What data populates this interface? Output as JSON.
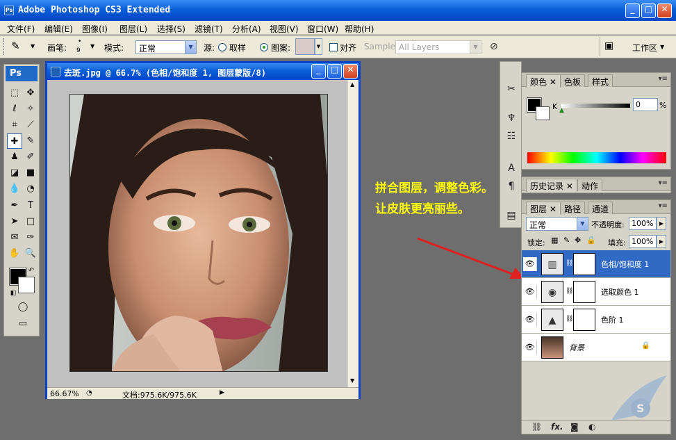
{
  "window": {
    "title": "Adobe Photoshop CS3 Extended",
    "minimize": "_",
    "maximize": "□",
    "close": "✕"
  },
  "menu": [
    "文件(F)",
    "编辑(E)",
    "图像(I)",
    "图层(L)",
    "选择(S)",
    "滤镜(T)",
    "分析(A)",
    "视图(V)",
    "窗口(W)",
    "帮助(H)"
  ],
  "options": {
    "brush_label": "画笔:",
    "brush_size": "9",
    "mode_label": "模式:",
    "mode_value": "正常",
    "source_label": "源:",
    "sampled_label": "取样",
    "pattern_label": "图案:",
    "aligned_label": "对齐",
    "sample_label": "Sample:",
    "sample_value": "All Layers",
    "workspace_label": "工作区"
  },
  "toolbox": {
    "logo": "Ps"
  },
  "document": {
    "title": "去斑.jpg @ 66.7% (色相/饱和度 1, 图层蒙版/8)",
    "zoom": "66.67%",
    "doc_info": "文档:975.6K/975.6K"
  },
  "annotation": "拼合图层，调整色彩。让皮肤更亮丽些。",
  "color_panel": {
    "tabs": [
      "颜色",
      "色板",
      "样式"
    ],
    "channel_label": "K",
    "value": "0",
    "unit": "%"
  },
  "history_panel": {
    "tabs": [
      "历史记录",
      "动作"
    ]
  },
  "layers_panel": {
    "tabs": [
      "图层",
      "路径",
      "通道"
    ],
    "blend_mode": "正常",
    "opacity_label": "不透明度:",
    "opacity_value": "100%",
    "lock_label": "锁定:",
    "fill_label": "填充:",
    "fill_value": "100%",
    "layers": [
      {
        "name": "色相/饱和度 1",
        "icon": "hue-saturation-icon",
        "selected": true
      },
      {
        "name": "选取颜色 1",
        "icon": "selective-color-icon",
        "selected": false
      },
      {
        "name": "色阶 1",
        "icon": "levels-icon",
        "selected": false
      },
      {
        "name": "背景",
        "icon": "background-photo-thumb",
        "selected": false
      }
    ],
    "footer_fx": "fx."
  },
  "colors": {
    "xp_blue": "#0a5fd8",
    "selected_layer": "#316ac5",
    "annotation": "#ffff00",
    "arrow": "#e02020"
  }
}
